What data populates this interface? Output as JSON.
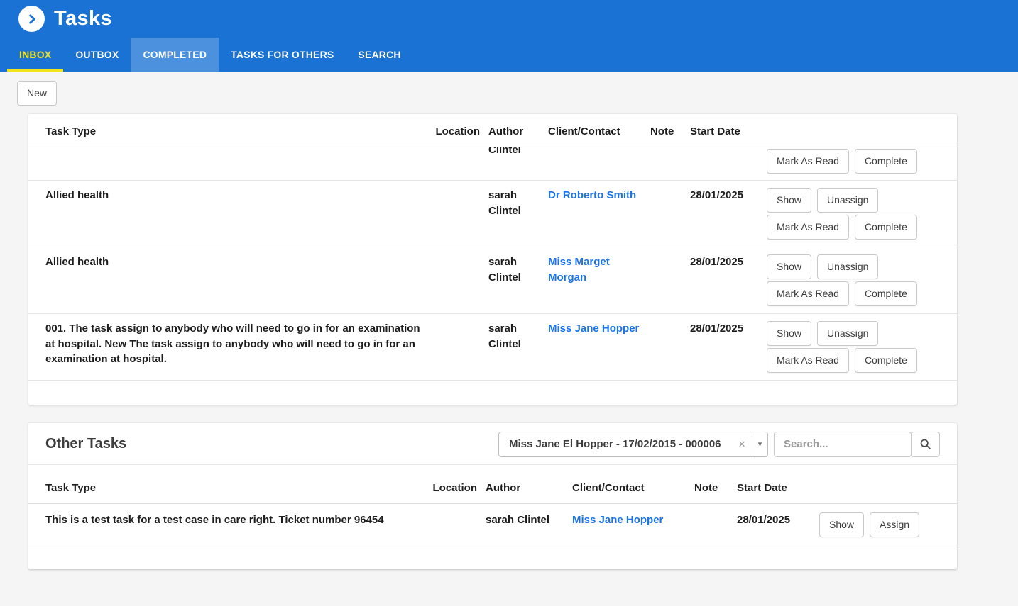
{
  "header": {
    "title": "Tasks",
    "tabs": [
      {
        "id": "inbox",
        "label": "INBOX",
        "state": "active"
      },
      {
        "id": "outbox",
        "label": "OUTBOX",
        "state": "default"
      },
      {
        "id": "completed",
        "label": "COMPLETED",
        "state": "selected"
      },
      {
        "id": "tasks-for-others",
        "label": "TASKS FOR OTHERS",
        "state": "default"
      },
      {
        "id": "search",
        "label": "SEARCH",
        "state": "default"
      }
    ]
  },
  "toolbar": {
    "new_label": "New"
  },
  "actions": {
    "show": "Show",
    "unassign": "Unassign",
    "mark_as_read": "Mark As Read",
    "complete": "Complete",
    "assign": "Assign"
  },
  "inbox": {
    "columns": [
      "Task Type",
      "Location",
      "Author",
      "Client/Contact",
      "Note",
      "Start Date"
    ],
    "partial_row": {
      "author_clipped": "Clintel"
    },
    "rows": [
      {
        "task_type": "Allied health",
        "location": "",
        "author": "sarah Clintel",
        "client": "Dr Roberto Smith",
        "note": "",
        "start_date": "28/01/2025"
      },
      {
        "task_type": "Allied health",
        "location": "",
        "author": "sarah Clintel",
        "client": "Miss Marget Morgan",
        "note": "",
        "start_date": "28/01/2025"
      },
      {
        "task_type": "001. The task assign to anybody who will need to go in for an examination at hospital. New The task assign to anybody who will need to go in for an examination at hospital.",
        "location": "",
        "author": "sarah Clintel",
        "client": "Miss Jane Hopper",
        "note": "",
        "start_date": "28/01/2025"
      }
    ]
  },
  "other_tasks": {
    "title": "Other Tasks",
    "client_filter_value": "Miss Jane El Hopper - 17/02/2015 - 000006",
    "search_placeholder": "Search...",
    "columns": [
      "Task Type",
      "Location",
      "Author",
      "Client/Contact",
      "Note",
      "Start Date"
    ],
    "rows": [
      {
        "task_type": "This is a test task for a test case in care right. Ticket number 96454",
        "location": "",
        "author": "sarah Clintel",
        "client": "Miss Jane Hopper",
        "note": "",
        "start_date": "28/01/2025"
      }
    ]
  },
  "icons": {
    "logo": "chevron-right-circle",
    "clear_glyph": "×",
    "dropdown_arrow_glyph": "▾",
    "search": "magnifier"
  },
  "colors": {
    "header_blue": "#1a72d4",
    "active_tab_yellow": "#f2e31d",
    "link_blue": "#1a73e8"
  }
}
